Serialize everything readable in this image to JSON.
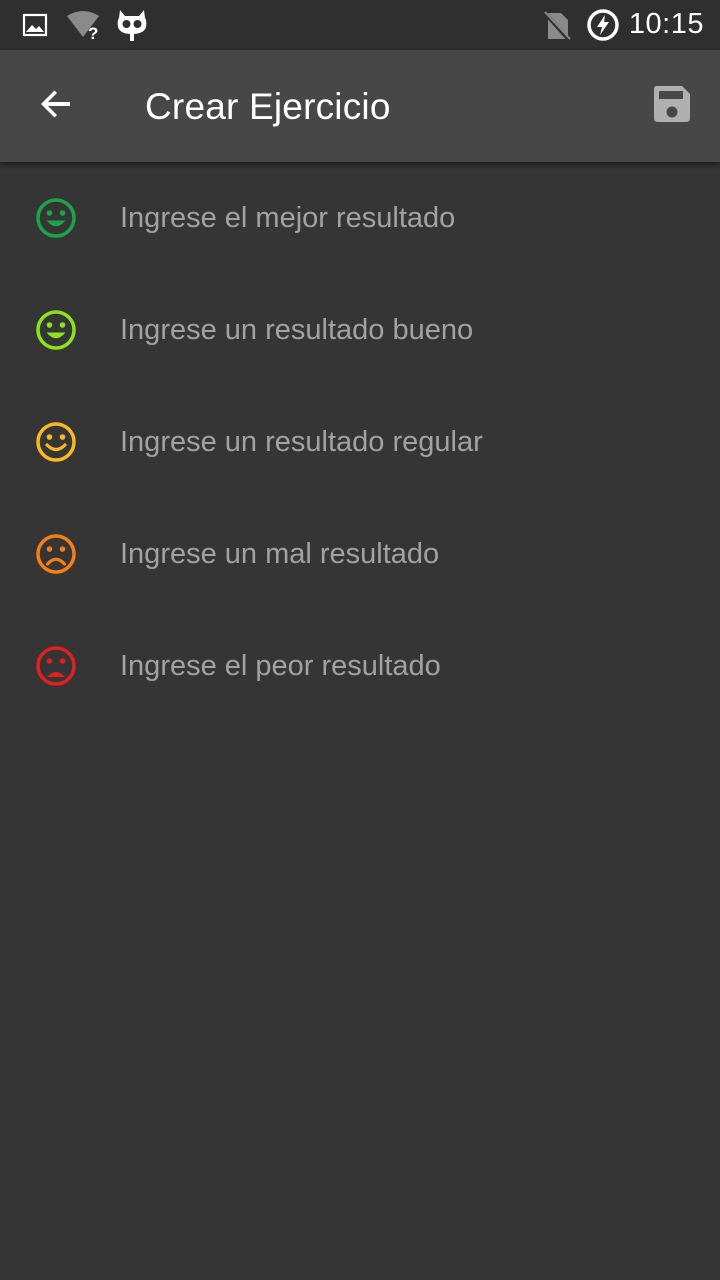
{
  "status_bar": {
    "time": "10:15",
    "icons": [
      "image-notification-icon",
      "wifi-unknown-icon",
      "cyanogen-mascot-icon",
      "no-sim-icon",
      "battery-charging-icon"
    ]
  },
  "app_bar": {
    "title": "Crear Ejercicio",
    "back_icon": "arrow-back-icon",
    "save_icon": "save-icon"
  },
  "results": [
    {
      "placeholder": "Ingrese el mejor resultado",
      "value": "",
      "icon": "very-happy-face-icon",
      "color": "#1aa648"
    },
    {
      "placeholder": "Ingrese un resultado bueno",
      "value": "",
      "icon": "happy-face-icon",
      "color": "#8de31b"
    },
    {
      "placeholder": "Ingrese un resultado regular",
      "value": "",
      "icon": "neutral-face-icon",
      "color": "#f8b91f"
    },
    {
      "placeholder": "Ingrese un mal resultado",
      "value": "",
      "icon": "sad-face-icon",
      "color": "#f57f17"
    },
    {
      "placeholder": "Ingrese el peor resultado",
      "value": "",
      "icon": "very-sad-face-icon",
      "color": "#e0211f"
    }
  ]
}
